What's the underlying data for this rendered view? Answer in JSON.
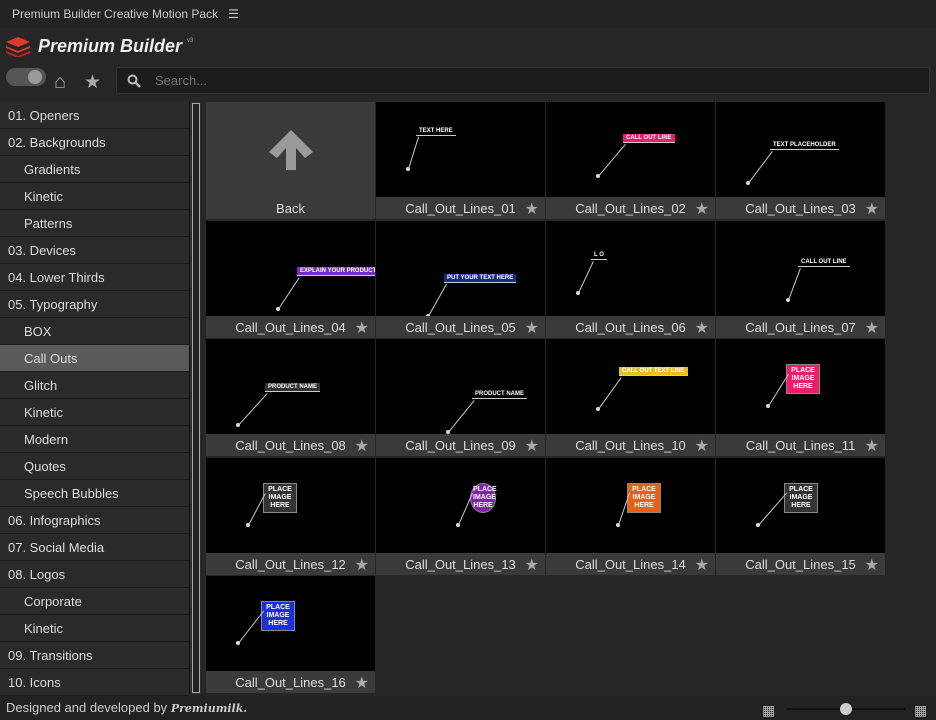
{
  "window": {
    "title": "Premium Builder Creative Motion Pack"
  },
  "brand": {
    "name": "Premium Builder",
    "version": "v3"
  },
  "search": {
    "placeholder": "Search..."
  },
  "sidebar": {
    "items": [
      {
        "label": "01. Openers",
        "sub": false
      },
      {
        "label": "02. Backgrounds",
        "sub": false
      },
      {
        "label": "Gradients",
        "sub": true
      },
      {
        "label": "Kinetic",
        "sub": true
      },
      {
        "label": "Patterns",
        "sub": true
      },
      {
        "label": "03. Devices",
        "sub": false
      },
      {
        "label": "04. Lower Thirds",
        "sub": false
      },
      {
        "label": "05. Typography",
        "sub": false
      },
      {
        "label": "BOX",
        "sub": true
      },
      {
        "label": "Call Outs",
        "sub": true,
        "active": true
      },
      {
        "label": "Glitch",
        "sub": true
      },
      {
        "label": "Kinetic",
        "sub": true
      },
      {
        "label": "Modern",
        "sub": true
      },
      {
        "label": "Quotes",
        "sub": true
      },
      {
        "label": "Speech Bubbles",
        "sub": true
      },
      {
        "label": "06. Infographics",
        "sub": false
      },
      {
        "label": "07. Social Media",
        "sub": false
      },
      {
        "label": "08. Logos",
        "sub": false
      },
      {
        "label": "Corporate",
        "sub": true
      },
      {
        "label": "Kinetic",
        "sub": true
      },
      {
        "label": "09. Transitions",
        "sub": false
      },
      {
        "label": "10. Icons",
        "sub": false
      }
    ]
  },
  "grid": {
    "back_label": "Back",
    "items": [
      {
        "name": "Call_Out_Lines_01",
        "text": "TEXT HERE",
        "color": "#000000"
      },
      {
        "name": "Call_Out_Lines_02",
        "text": "CALL OUT LINE",
        "color": "#e8206a"
      },
      {
        "name": "Call_Out_Lines_03",
        "text": "TEXT PLACEHOLDER",
        "color": "#000000"
      },
      {
        "name": "Call_Out_Lines_04",
        "text": "EXPLAIN YOUR PRODUCT",
        "color": "#7a2ad0"
      },
      {
        "name": "Call_Out_Lines_05",
        "text": "PUT YOUR TEXT HERE",
        "color": "#1a2a8a"
      },
      {
        "name": "Call_Out_Lines_06",
        "text": "L O",
        "color": "#000000"
      },
      {
        "name": "Call_Out_Lines_07",
        "text": "CALL OUT LINE",
        "color": "#000000"
      },
      {
        "name": "Call_Out_Lines_08",
        "text": "PRODUCT NAME",
        "color": "#333333"
      },
      {
        "name": "Call_Out_Lines_09",
        "text": "PRODUCT NAME",
        "color": "#000000"
      },
      {
        "name": "Call_Out_Lines_10",
        "text": "CALL OUT TEXT LINE",
        "color": "#e8c020"
      },
      {
        "name": "Call_Out_Lines_11",
        "text": "PLACE IMAGE HERE",
        "color": "#e8206a"
      },
      {
        "name": "Call_Out_Lines_12",
        "text": "PLACE IMAGE HERE",
        "color": "#333333"
      },
      {
        "name": "Call_Out_Lines_13",
        "text": "PLACE IMAGE HERE",
        "color": "#8a1ab0"
      },
      {
        "name": "Call_Out_Lines_14",
        "text": "PLACE IMAGE HERE",
        "color": "#e86010"
      },
      {
        "name": "Call_Out_Lines_15",
        "text": "PLACE IMAGE HERE",
        "color": "#333333"
      },
      {
        "name": "Call_Out_Lines_16",
        "text": "PLACE IMAGE HERE",
        "color": "#1a30e0"
      }
    ]
  },
  "footer": {
    "text": "Designed and developed by",
    "signature": "Premiumilk."
  }
}
